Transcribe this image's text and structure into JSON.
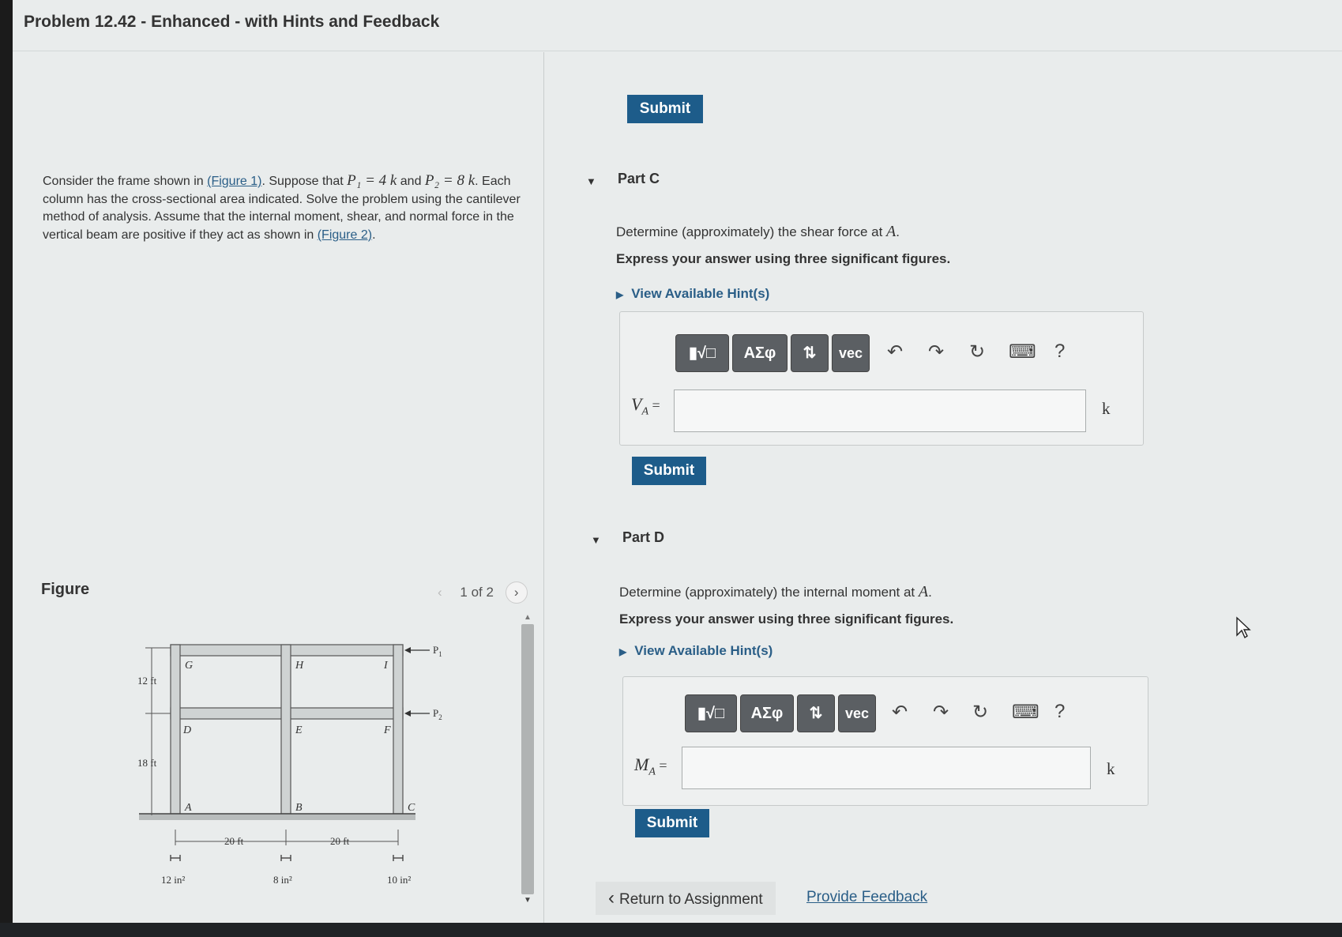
{
  "header": {
    "title": "Problem 12.42 - Enhanced - with Hints and Feedback"
  },
  "problem": {
    "text_1": "Consider the frame shown in ",
    "figure1_link": "(Figure 1)",
    "text_2": ". Suppose that ",
    "p1": "P₁ = 4 k",
    "text_3": " and ",
    "p2": "P₂ = 8 k",
    "text_4": ". Each column has the cross-sectional area indicated. Solve the problem using the cantilever method of analysis. Assume that the internal moment, shear, and normal force in the vertical beam are positive if they act as shown in ",
    "figure2_link": "(Figure 2)",
    "text_5": "."
  },
  "figure": {
    "label": "Figure",
    "pager": "1 of 2",
    "prev_icon": "chevron-left-icon",
    "next_icon": "chevron-right-icon",
    "joints": {
      "g": "G",
      "h": "H",
      "i": "I",
      "d": "D",
      "e": "E",
      "f": "F",
      "a": "A",
      "b": "B",
      "c": "C"
    },
    "loads": {
      "p1": "P",
      "p1_sub": "1",
      "p2": "P",
      "p2_sub": "2"
    },
    "dims": {
      "h_top": "12 ft",
      "h_bottom": "18 ft",
      "span1": "20 ft",
      "span2": "20 ft"
    },
    "areas": {
      "a": "12 in²",
      "b": "8 in²",
      "c": "10 in²"
    }
  },
  "top_submit": "Submit",
  "part_c": {
    "title": "Part C",
    "question_1": "Determine (approximately) the shear force at ",
    "question_var": "A",
    "question_2": ".",
    "instruction": "Express your answer using three significant figures.",
    "hint": "View Available Hint(s)",
    "var": "V",
    "var_sub": "A",
    "equals": " =",
    "input_value": "",
    "unit": "k",
    "submit": "Submit"
  },
  "part_d": {
    "title": "Part D",
    "question_1": "Determine (approximately) the internal moment at ",
    "question_var": "A",
    "question_2": ".",
    "instruction": "Express your answer using three significant figures.",
    "hint": "View Available Hint(s)",
    "var": "M",
    "var_sub": "A",
    "equals": " =",
    "input_value": "",
    "unit": "k",
    "submit": "Submit"
  },
  "toolbar": {
    "templates": "▮√□",
    "greek": "ΑΣφ",
    "updown": "⇅",
    "vec": "vec",
    "undo_icon": "↶",
    "redo_icon": "↷",
    "reset_icon": "↻",
    "keyboard_icon": "⌨",
    "help": "?"
  },
  "footer": {
    "return": "Return to Assignment",
    "return_icon": "‹",
    "feedback": "Provide Feedback"
  }
}
